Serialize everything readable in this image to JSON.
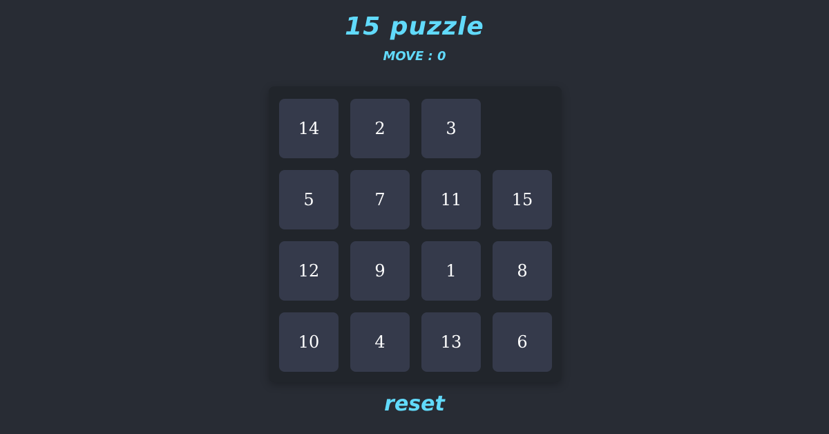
{
  "game": {
    "title": "15 puzzle",
    "moves_label": "MOVE : 0"
  },
  "board": {
    "rows": 4,
    "cols": 4,
    "tiles": [
      [
        "14",
        "2",
        "3",
        ""
      ],
      [
        "5",
        "7",
        "11",
        "15"
      ],
      [
        "12",
        "9",
        "1",
        "8"
      ],
      [
        "10",
        "4",
        "13",
        "6"
      ]
    ]
  },
  "controls": {
    "reset_label": "reset"
  },
  "colors": {
    "background": "#282c34",
    "board": "#21252b",
    "tile": "#353a4b",
    "accent": "#61dafb",
    "tile_text": "#ffffff"
  }
}
